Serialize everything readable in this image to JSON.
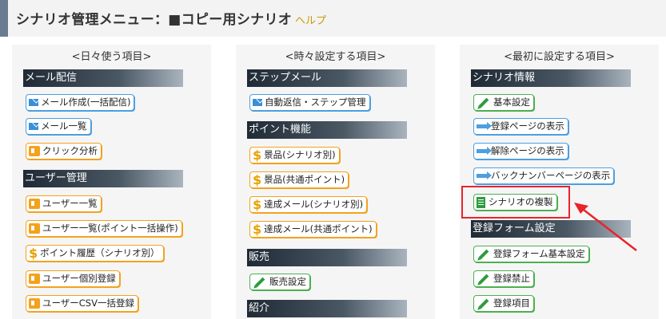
{
  "header": {
    "title": "シナリオ管理メニュー：■コピー用シナリオ",
    "help_label": "ヘルプ"
  },
  "columns": [
    {
      "title": "<日々使う項目>",
      "sections": [
        {
          "label": "メール配信",
          "items": [
            "メール作成(一括配信)",
            "メール一覧",
            "クリック分析"
          ]
        },
        {
          "label": "ユーザー管理",
          "items": [
            "ユーザー一覧",
            "ユーザー一覧(ポイント一括操作)",
            "ポイント履歴（シナリオ別）",
            "ユーザー個別登録",
            "ユーザーCSV一括登録"
          ]
        }
      ]
    },
    {
      "title": "<時々設定する項目>",
      "sections": [
        {
          "label": "ステップメール",
          "items": [
            "自動返信・ステップ管理"
          ]
        },
        {
          "label": "ポイント機能",
          "items": [
            "景品(シナリオ別)",
            "景品(共通ポイント)",
            "達成メール(シナリオ別)",
            "達成メール(共通ポイント)"
          ]
        },
        {
          "label": "販売",
          "items": [
            "販売設定"
          ]
        },
        {
          "label": "紹介",
          "items": []
        }
      ]
    },
    {
      "title": "<最初に設定する項目>",
      "sections": [
        {
          "label": "シナリオ情報",
          "items": [
            "基本設定",
            "登録ページの表示",
            "解除ページの表示",
            "バックナンバーページの表示",
            "シナリオの複製"
          ]
        },
        {
          "label": "登録フォーム設定",
          "items": [
            "登録フォーム基本設定",
            "登録禁止",
            "登録項目"
          ]
        }
      ]
    }
  ],
  "colors": {
    "highlight": "#e8242a",
    "button_blue": "#4c9fe0",
    "button_orange": "#f3a21e",
    "button_green": "#4caf50",
    "help_link": "#c99a00"
  }
}
